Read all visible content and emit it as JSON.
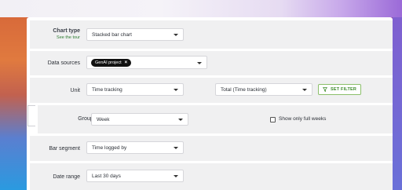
{
  "chart_type": {
    "label": "Chart type",
    "tour_link": "See the tour",
    "value": "Stacked bar chart"
  },
  "data_sources": {
    "label": "Data sources",
    "chips": [
      {
        "label": "GenAI project"
      }
    ]
  },
  "unit": {
    "label": "Unit",
    "value": "Time tracking",
    "total_value": "Total (Time tracking)",
    "set_filter_label": "SET FILTER"
  },
  "group_by": {
    "label": "Group by",
    "value": "Week",
    "checkbox_label": "Show only full weeks",
    "checked": false
  },
  "bar_segment": {
    "label": "Bar segment",
    "value": "Time logged by"
  },
  "date_range": {
    "label": "Date range",
    "value": "Last 30 days"
  }
}
